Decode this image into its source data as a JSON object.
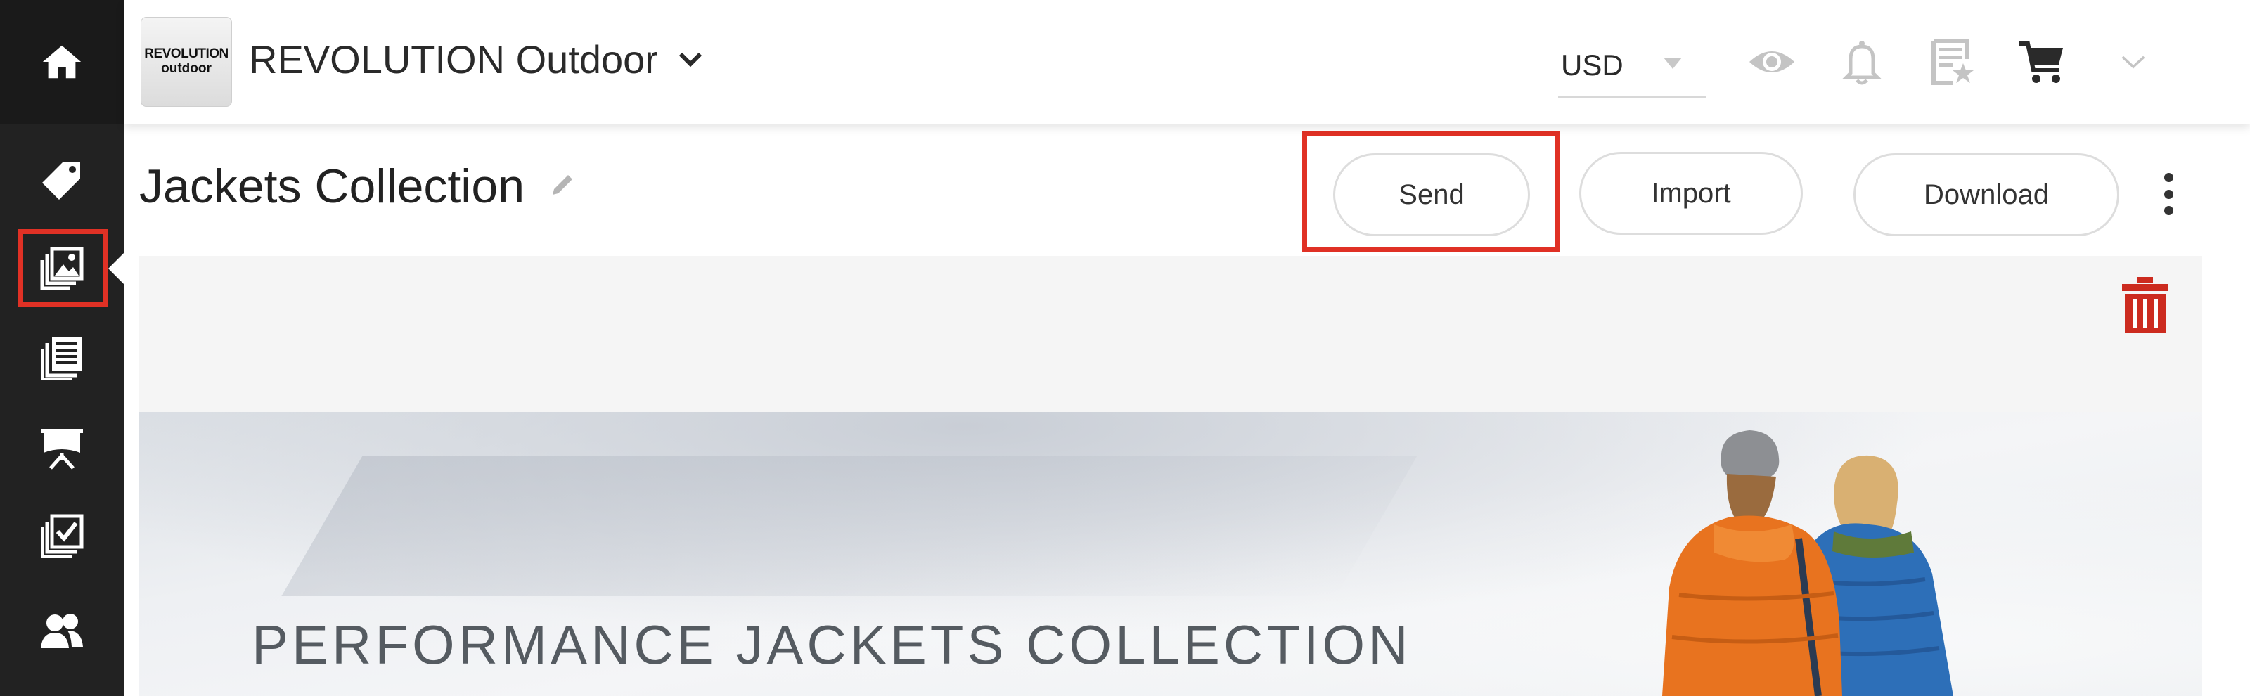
{
  "header": {
    "logo": {
      "line1": "REVOLUTION",
      "line2": "outdoor"
    },
    "brand_name": "REVOLUTION Outdoor",
    "currency": "USD"
  },
  "page": {
    "title": "Jackets Collection"
  },
  "toolbar": {
    "send_label": "Send",
    "import_label": "Import",
    "download_label": "Download"
  },
  "banner": {
    "headline": "PERFORMANCE JACKETS COLLECTION"
  },
  "sidebar": {
    "items": [
      {
        "icon": "home-icon"
      },
      {
        "icon": "price-tag-icon"
      },
      {
        "icon": "collections-icon",
        "active": true
      },
      {
        "icon": "catalog-list-icon"
      },
      {
        "icon": "presentation-icon"
      },
      {
        "icon": "checklist-icon"
      },
      {
        "icon": "users-icon"
      }
    ]
  },
  "colors": {
    "sidebar_bg": "#222222",
    "highlight": "#e03125",
    "trash": "#cc2b1f",
    "jacket_orange": "#e8731f",
    "jacket_blue": "#2d6fb8"
  }
}
